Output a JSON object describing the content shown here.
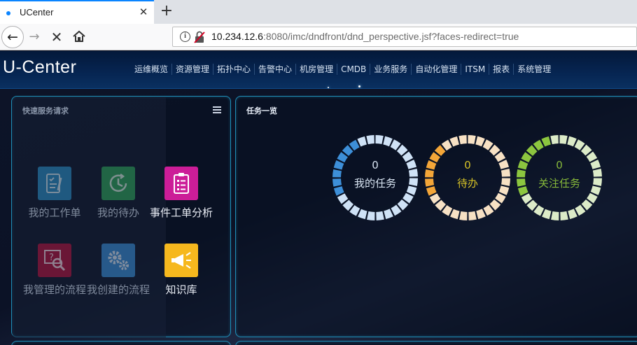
{
  "browser": {
    "tab_title": "UCenter",
    "tab_close": "✕",
    "new_tab": "+",
    "url_host": "10.234.12.6",
    "url_rest": ":8080/imc/dndfront/dnd_perspective.jsf?faces-redirect=true"
  },
  "header": {
    "logo": "U-Center",
    "nav": [
      "运维概览",
      "资源管理",
      "拓扑中心",
      "告警中心",
      "机房管理",
      "CMDB",
      "业务服务",
      "自动化管理",
      "ITSM",
      "报表",
      "系统管理"
    ]
  },
  "quick_panel": {
    "title": "快速服务请求",
    "tiles": [
      {
        "label": "我的工作单",
        "icon": "checklist-icon",
        "color": "#2b8fc4"
      },
      {
        "label": "我的待办",
        "icon": "clock-refresh-icon",
        "color": "#2fa35a"
      },
      {
        "label": "事件工单分析",
        "icon": "clipboard-list-icon",
        "color": "#cc1d98"
      },
      {
        "label": "我管理的流程",
        "icon": "magnifier-question-icon",
        "color": "#b3143f"
      },
      {
        "label": "我创建的流程",
        "icon": "gears-icon",
        "color": "#3a8fd6"
      },
      {
        "label": "知识库",
        "icon": "megaphone-icon",
        "color": "#f6b81e"
      }
    ]
  },
  "task_panel": {
    "title": "任务一览",
    "rings": [
      {
        "count": "0",
        "label": "我的任务",
        "accent": "#3d8fd8",
        "soft": "#cfe2f6",
        "text_color": "#d8e4f2",
        "fill_fraction": 0.25
      },
      {
        "count": "0",
        "label": "待办",
        "accent": "#f4a638",
        "soft": "#f7e1c4",
        "text_color": "#d7c227",
        "fill_fraction": 0.22
      },
      {
        "count": "0",
        "label": "关注任务",
        "accent": "#8cc63f",
        "soft": "#dcebc8",
        "text_color": "#86b83a",
        "fill_fraction": 0.3
      }
    ]
  }
}
